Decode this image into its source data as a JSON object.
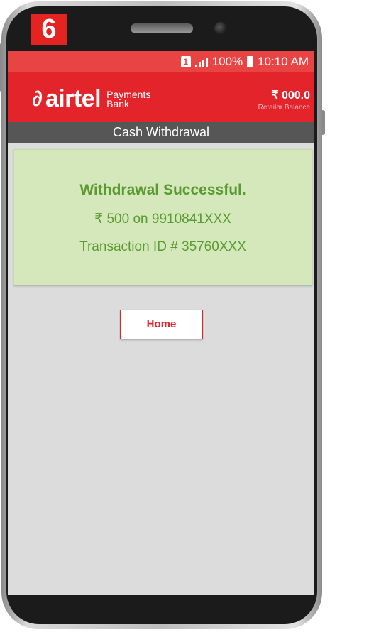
{
  "step_badge": "6",
  "status_bar": {
    "sim": "1",
    "battery_percent": "100%",
    "time": "10:10 AM"
  },
  "header": {
    "brand": "airtel",
    "brand_sub_line1": "Payments",
    "brand_sub_line2": "Bank",
    "balance_amount": "₹ 000.0",
    "balance_label": "Retailor Balance"
  },
  "page_title": "Cash Withdrawal",
  "result": {
    "title": "Withdrawal Successful.",
    "amount_line": "₹ 500 on 9910841XXX",
    "transaction_line": "Transaction ID # 35760XXX"
  },
  "home_button_label": "Home",
  "colors": {
    "brand_red": "#e3242b",
    "status_red": "#e84444",
    "success_green": "#5a9a30",
    "card_green": "#d5e8bb",
    "title_bar_gray": "#565656",
    "screen_bg": "#dcdcdc"
  }
}
